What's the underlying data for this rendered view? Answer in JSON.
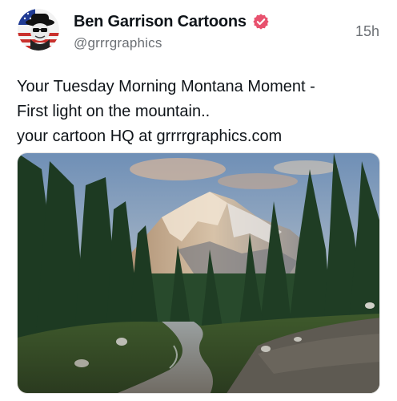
{
  "post": {
    "author": {
      "display_name": "Ben Garrison Cartoons",
      "handle": "@grrrgraphics",
      "verified_icon": "verified-badge-icon",
      "verified_color": "#e8516e"
    },
    "timestamp": "15h",
    "text_lines": [
      "Your Tuesday Morning Montana Moment -",
      "First light on the mountain..",
      "your cartoon HQ at grrrrgraphics.com"
    ],
    "media": {
      "kind": "photo"
    }
  }
}
